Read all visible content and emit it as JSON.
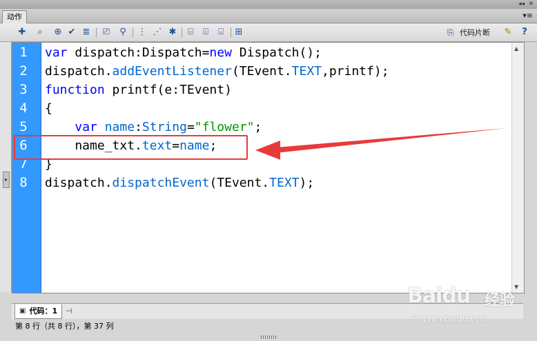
{
  "panel": {
    "tab_label": "动作",
    "collapse_glyph": "◂◂",
    "close_glyph": "✕",
    "menu_glyph": "▾≡"
  },
  "toolbar": {
    "icons": [
      {
        "name": "add-script-item-icon",
        "glyph": "✚"
      },
      {
        "name": "find-icon",
        "glyph": "⌕"
      },
      {
        "name": "insert-target-path-icon",
        "glyph": "⊕"
      },
      {
        "name": "check-syntax-icon",
        "glyph": "✔"
      },
      {
        "name": "auto-format-icon",
        "glyph": "≣"
      },
      {
        "name": "show-code-hint-icon",
        "glyph": "⎚"
      },
      {
        "name": "debug-options-icon",
        "glyph": "⚲"
      },
      {
        "name": "collapse-between-braces-icon",
        "glyph": "⋮"
      },
      {
        "name": "collapse-selection-icon",
        "glyph": "⋰"
      },
      {
        "name": "expand-all-icon",
        "glyph": "✱"
      },
      {
        "name": "apply-block-comment-icon",
        "glyph": "⌸"
      },
      {
        "name": "apply-line-comment-icon",
        "glyph": "⌹"
      },
      {
        "name": "remove-comment-icon",
        "glyph": "⌺"
      },
      {
        "name": "show-hide-toolbox-icon",
        "glyph": "⊞"
      }
    ],
    "snippet_label": "代码片断",
    "snippet_glyph": "⎘",
    "wand_glyph": "✎",
    "help_glyph": "?"
  },
  "editor": {
    "line_numbers": [
      "1",
      "2",
      "3",
      "4",
      "5",
      "6",
      "7",
      "8"
    ],
    "highlighted_line": 6
  },
  "bottom": {
    "code_tab_label": "代码：1",
    "code_tab_glyph": "▣",
    "pin_glyph": "⊣"
  },
  "status": {
    "text": "第 8 行（共 8 行），第 37 列"
  },
  "watermark": {
    "brand": "Baidu",
    "suffix": "经验",
    "url": "jingyan.baidu.com"
  },
  "colors": {
    "gutter": "#3399ff",
    "keyword": "#0000ff",
    "string": "#009900",
    "annotation": "#e83a3a"
  }
}
